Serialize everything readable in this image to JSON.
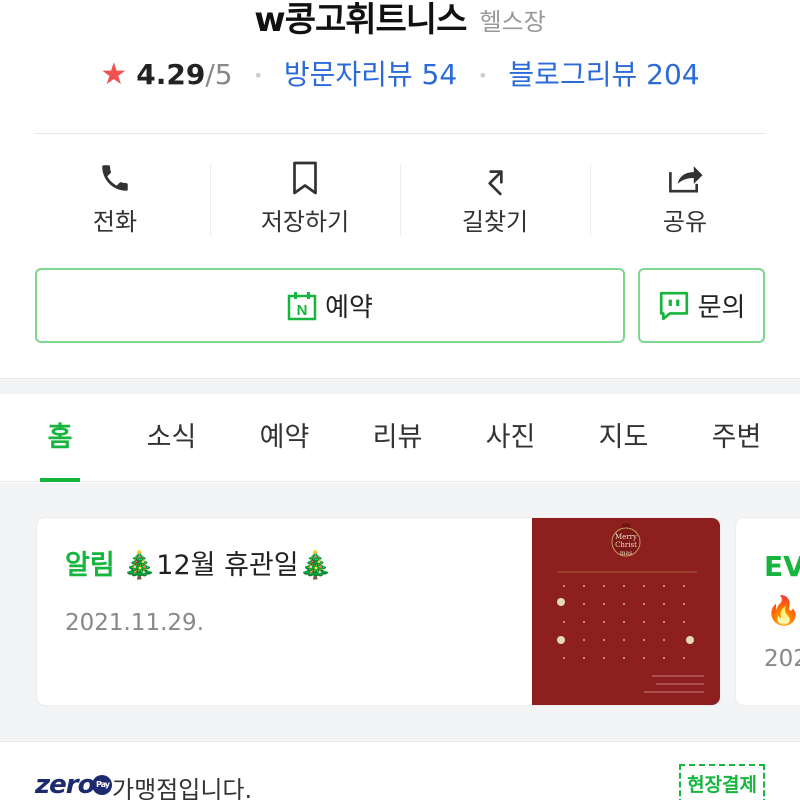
{
  "place": {
    "name": "w콩고휘트니스",
    "category": "헬스장"
  },
  "rating": {
    "score": "4.29",
    "out_of": "/5",
    "visitor_reviews_label": "방문자리뷰",
    "visitor_reviews_count": "54",
    "blog_reviews_label": "블로그리뷰",
    "blog_reviews_count": "204"
  },
  "actions": {
    "call": "전화",
    "save": "저장하기",
    "directions": "길찾기",
    "share": "공유"
  },
  "buttons": {
    "reserve": "예약",
    "reserve_badge": "N",
    "inquiry": "문의"
  },
  "tabs": [
    "홈",
    "소식",
    "예약",
    "리뷰",
    "사진",
    "지도",
    "주변"
  ],
  "feed": {
    "card1": {
      "tag": "알림",
      "title": "🎄12월 휴관일🎄",
      "date": "2021.11.29.",
      "thumb_text": "Merry Christ mas"
    },
    "card2": {
      "tag": "EV",
      "emoji": "🔥",
      "date_partial": "202"
    }
  },
  "zeropay": {
    "logo": "zero",
    "pay_badge": "Pay",
    "text": "가맹점입니다.",
    "onsite_label": "현장결제"
  },
  "colors": {
    "accent_green": "#16b53e",
    "link_blue": "#2b6ad8",
    "star_red": "#f2524f",
    "card_thumb_red": "#8e1f1f"
  }
}
